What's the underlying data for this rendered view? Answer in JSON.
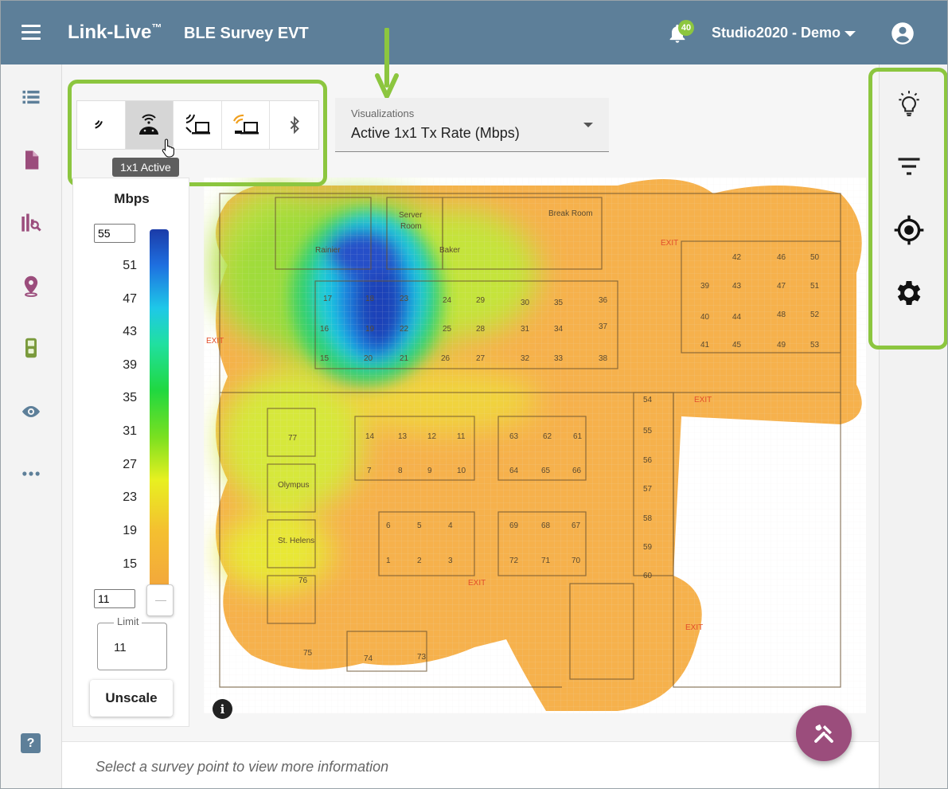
{
  "header": {
    "app_name": "Link-Live",
    "app_trademark": "™",
    "project_name": "BLE Survey EVT",
    "notification_count": "40",
    "organization": "Studio2020 - Demo"
  },
  "left_nav": {
    "items": [
      "list-icon",
      "document-icon",
      "analytics-icon",
      "location-pin-icon",
      "tester-device-icon",
      "eye-icon",
      "more-icon"
    ],
    "help_label": "?"
  },
  "mode_bar": {
    "buttons": [
      "signal-icon",
      "android-wifi-icon",
      "device-signal-icon",
      "device-wifi-icon",
      "bluetooth-icon"
    ],
    "active_index": 1,
    "tooltip": "1x1 Active"
  },
  "visualization": {
    "label": "Visualizations",
    "value": "Active 1x1 Tx Rate (Mbps)"
  },
  "legend": {
    "unit": "Mbps",
    "max_input": "55",
    "min_input": "11",
    "ticks": [
      "51",
      "47",
      "43",
      "39",
      "35",
      "31",
      "27",
      "23",
      "19",
      "15"
    ],
    "limit_label": "Limit",
    "limit_value": "11",
    "unscale_label": "Unscale"
  },
  "floorplan": {
    "rooms": [
      "Server",
      "Room",
      "Break Room",
      "Rainier",
      "Baker",
      "Olympus",
      "St. Helens"
    ],
    "exit_label": "EXIT",
    "seat_numbers": [
      "17",
      "18",
      "23",
      "24",
      "29",
      "30",
      "35",
      "36",
      "16",
      "19",
      "22",
      "25",
      "28",
      "31",
      "34",
      "37",
      "15",
      "20",
      "21",
      "26",
      "27",
      "32",
      "33",
      "38",
      "42",
      "46",
      "50",
      "39",
      "43",
      "47",
      "51",
      "40",
      "44",
      "48",
      "52",
      "41",
      "45",
      "49",
      "53",
      "54",
      "55",
      "56",
      "57",
      "58",
      "59",
      "60",
      "14",
      "13",
      "12",
      "11",
      "63",
      "62",
      "61",
      "7",
      "8",
      "9",
      "10",
      "64",
      "65",
      "66",
      "6",
      "5",
      "4",
      "69",
      "68",
      "67",
      "1",
      "2",
      "3",
      "72",
      "71",
      "70",
      "77",
      "76",
      "75",
      "74",
      "73"
    ]
  },
  "status": {
    "message": "Select a survey point to view more information"
  },
  "right_rail": {
    "items": [
      "lightbulb-icon",
      "filter-icon",
      "target-icon",
      "gear-icon"
    ]
  },
  "colors": {
    "header_bg": "#5d7f99",
    "highlight": "#8cc63f",
    "fab": "#9b4d7c",
    "nav_accent": "#9b4d7c",
    "heat_orange": "#f3a73c"
  }
}
